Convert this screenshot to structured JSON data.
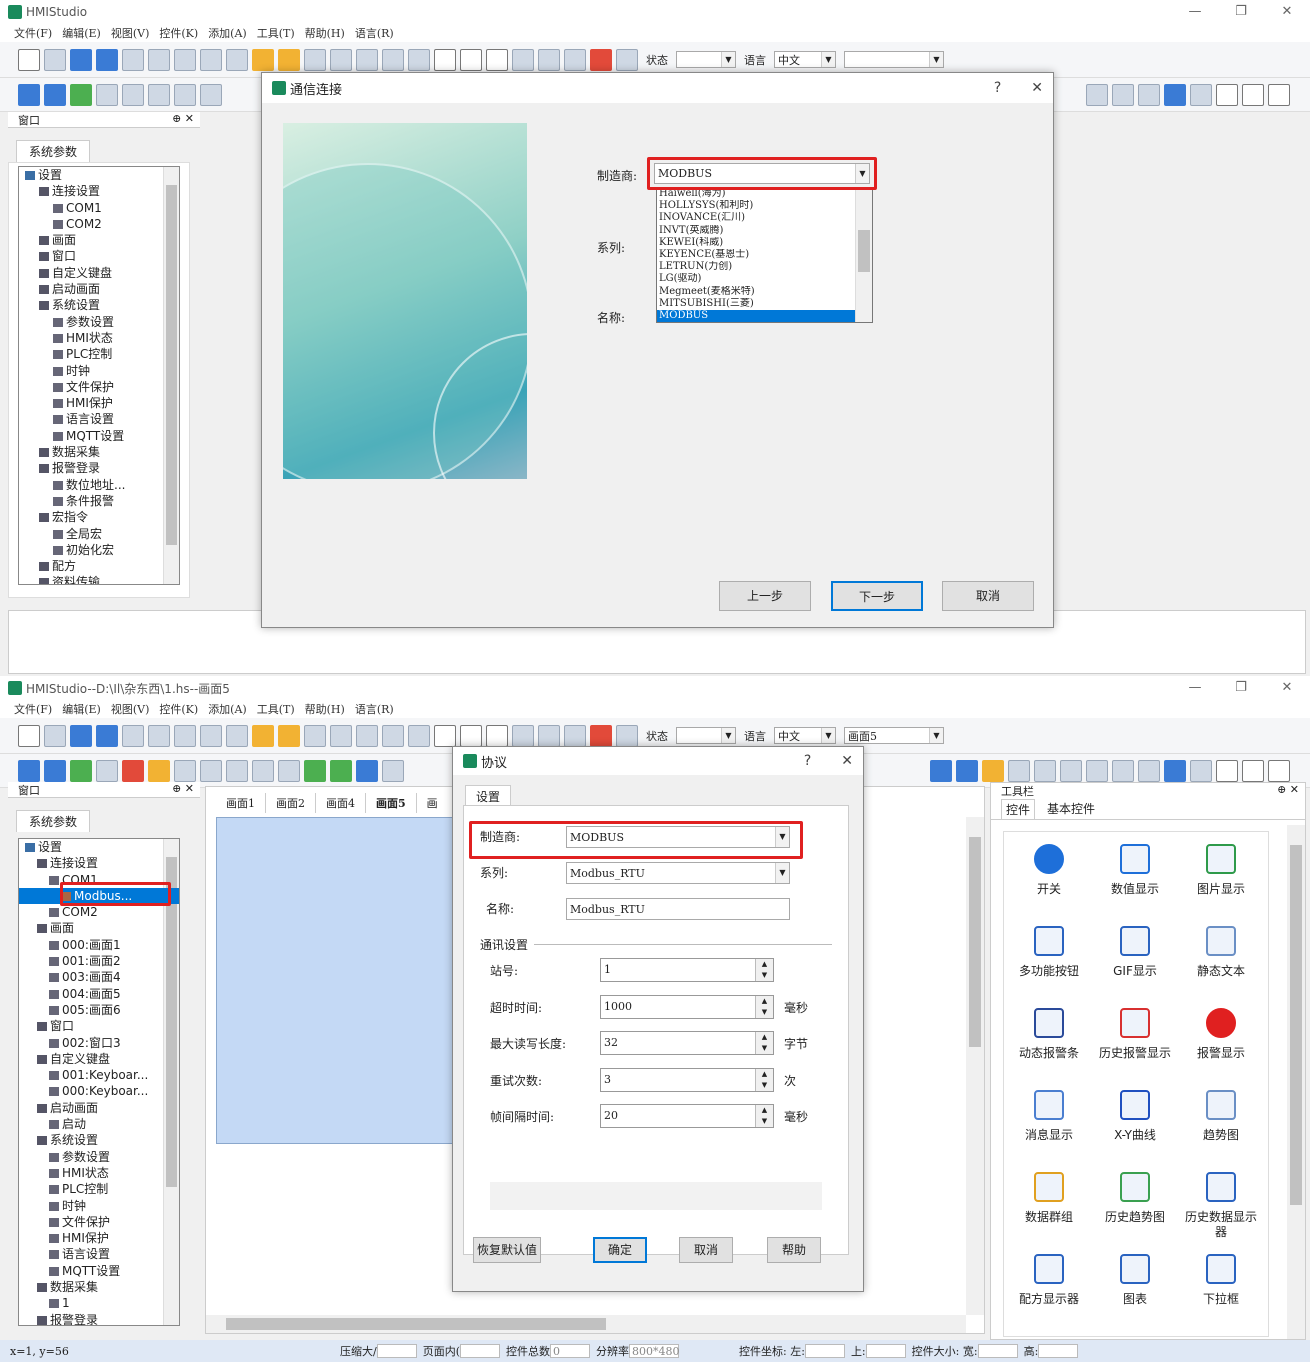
{
  "win1": {
    "title": "HMIStudio",
    "menu": [
      "文件(F)",
      "编辑(E)",
      "视图(V)",
      "控件(K)",
      "添加(A)",
      "工具(T)",
      "帮助(H)",
      "语言(R)"
    ],
    "toolbar": {
      "state_label": "状态",
      "lang_label": "语言",
      "lang_value": "中文",
      "screen_value": ""
    },
    "panel_title": "窗口",
    "tab": "系统参数",
    "tree": [
      "设置",
      "连接设置",
      "COM1",
      "COM2",
      "画面",
      "窗口",
      "自定义键盘",
      "启动画面",
      "系统设置",
      "参数设置",
      "HMI状态",
      "PLC控制",
      "时钟",
      "文件保护",
      "HMI保护",
      "语言设置",
      "MQTT设置",
      "数据采集",
      "报警登录",
      "数位地址...",
      "条件报警",
      "宏指令",
      "全局宏",
      "初始化宏",
      "配方",
      "资料传输"
    ],
    "dialog": {
      "title": "通信连接",
      "help": "?",
      "close": "✕",
      "manufacturer_label": "制造商:",
      "manufacturer_value": "MODBUS",
      "series_label": "系列:",
      "name_label": "名称:",
      "dropdown": [
        "Haiwell(海为)",
        "HOLLYSYS(和利时)",
        "INOVANCE(汇川)",
        "INVT(英威腾)",
        "KEWEI(科威)",
        "KEYENCE(基恩士)",
        "LETRUN(力创)",
        "LG(驱动)",
        "Megmeet(麦格米特)",
        "MITSUBISHI(三菱)",
        "MODBUS"
      ],
      "prev": "上一步",
      "next": "下一步",
      "cancel": "取消"
    }
  },
  "win2": {
    "title": "HMIStudio--D:\\Il\\杂东西\\1.hs--画面5",
    "menu": [
      "文件(F)",
      "编辑(E)",
      "视图(V)",
      "控件(K)",
      "添加(A)",
      "工具(T)",
      "帮助(H)",
      "语言(R)"
    ],
    "toolbar": {
      "state_label": "状态",
      "lang_label": "语言",
      "lang_value": "中文",
      "screen_value": "画面5"
    },
    "panel_title": "窗口",
    "tab": "系统参数",
    "tree": [
      "设置",
      "连接设置",
      "COM1",
      "Modbus...",
      "COM2",
      "画面",
      "000:画面1",
      "001:画面2",
      "003:画面4",
      "004:画面5",
      "005:画面6",
      "窗口",
      "002:窗口3",
      "自定义键盘",
      "001:Keyboar...",
      "000:Keyboar...",
      "启动画面",
      "启动",
      "系统设置",
      "参数设置",
      "HMI状态",
      "PLC控制",
      "时钟",
      "文件保护",
      "HMI保护",
      "语言设置",
      "MQTT设置",
      "数据采集",
      "1",
      "报警登录"
    ],
    "screen_tabs": [
      "画面1",
      "画面2",
      "画面4",
      "画面5",
      "画"
    ],
    "dialog": {
      "title": "协议",
      "help": "?",
      "close": "✕",
      "tab": "设置",
      "manufacturer_label": "制造商:",
      "manufacturer_value": "MODBUS",
      "series_label": "系列:",
      "series_value": "Modbus_RTU",
      "name_label": "名称:",
      "name_value": "Modbus_RTU",
      "comm_group": "通讯设置",
      "fields": [
        {
          "label": "站号:",
          "value": "1",
          "unit": ""
        },
        {
          "label": "超时时间:",
          "value": "1000",
          "unit": "毫秒"
        },
        {
          "label": "最大读写长度:",
          "value": "32",
          "unit": "字节"
        },
        {
          "label": "重试次数:",
          "value": "3",
          "unit": "次"
        },
        {
          "label": "帧间隔时间:",
          "value": "20",
          "unit": "毫秒"
        }
      ],
      "restore": "恢复默认值",
      "ok": "确定",
      "cancel": "取消",
      "help_btn": "帮助"
    },
    "toolbox": {
      "title": "工具栏",
      "tabs": [
        "控件",
        "基本控件"
      ],
      "items": [
        "开关",
        "数值显示",
        "图片显示",
        "多功能按钮",
        "GIF显示",
        "静态文本",
        "动态报警条",
        "历史报警显示",
        "报警显示",
        "消息显示",
        "X-Y曲线",
        "趋势图",
        "数据群组",
        "历史趋势图",
        "历史数据显示器",
        "配方显示器",
        "图表",
        "下拉框"
      ]
    },
    "status": {
      "coords": "x=1, y=56",
      "compress": "压缩大/",
      "page_mem": "页面内(",
      "total_ctrl": "控件总数",
      "total_value": "0",
      "resolution_label": "分辨率",
      "resolution": "800*480",
      "ctrl_pos": "控件坐标: 左:",
      "top": "上:",
      "ctrl_size": "控件大小: 宽:",
      "height": "高:"
    }
  }
}
